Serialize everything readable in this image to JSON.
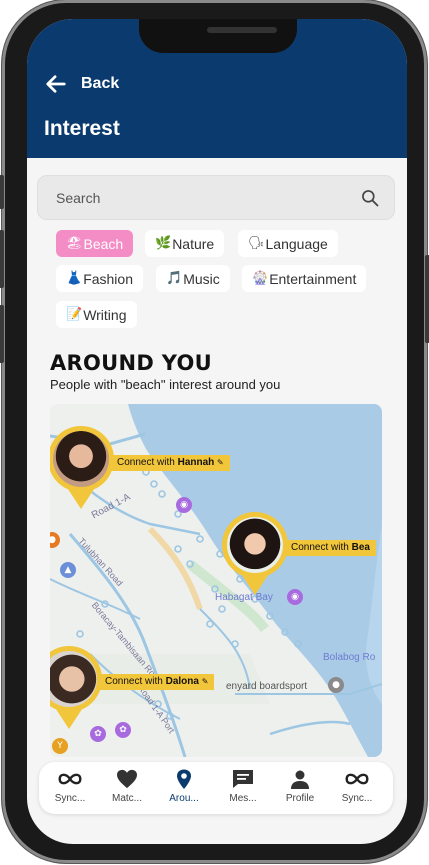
{
  "header": {
    "back_label": "Back",
    "title": "Interest"
  },
  "search": {
    "placeholder": "Search"
  },
  "interests": [
    {
      "emoji": "🏖",
      "label": "Beach",
      "active": true
    },
    {
      "emoji": "🌿",
      "label": "Nature",
      "active": false
    },
    {
      "emoji": "🗣",
      "label": "Language",
      "active": false
    },
    {
      "emoji": "👗",
      "label": "Fashion",
      "active": false
    },
    {
      "emoji": "🎵",
      "label": "Music",
      "active": false
    },
    {
      "emoji": "🎡",
      "label": "Entertainment",
      "active": false
    },
    {
      "emoji": "📝",
      "label": "Writing",
      "active": false
    }
  ],
  "around": {
    "title": "AROUND YOU",
    "subtitle": "People with \"beach\" interest around you"
  },
  "map": {
    "people": [
      {
        "prefix": "Connect with",
        "name": "Hannah"
      },
      {
        "prefix": "Connect with",
        "name": "Bea"
      },
      {
        "prefix": "Connect with",
        "name": "Dalona"
      }
    ],
    "road_labels": [
      "Road 1-A",
      "Tulubhan Road",
      "Boracay-Tambisaan Road",
      "Road 1-A Port"
    ],
    "place_labels": [
      "Habagat Bay",
      "Bolabog Ro",
      "enyard boardsport"
    ],
    "colors": {
      "water": "#a9cbe6",
      "land": "#eef0ee",
      "road": "#9dc6e3",
      "pin": "#f2c63a"
    }
  },
  "tabs": [
    {
      "icon": "infinity-icon",
      "label": "Sync..."
    },
    {
      "icon": "heart-icon",
      "label": "Matc..."
    },
    {
      "icon": "location-pin-icon",
      "label": "Arou...",
      "active": true
    },
    {
      "icon": "message-icon",
      "label": "Mes..."
    },
    {
      "icon": "profile-icon",
      "label": "Profile"
    },
    {
      "icon": "infinity-icon",
      "label": "Sync..."
    }
  ]
}
